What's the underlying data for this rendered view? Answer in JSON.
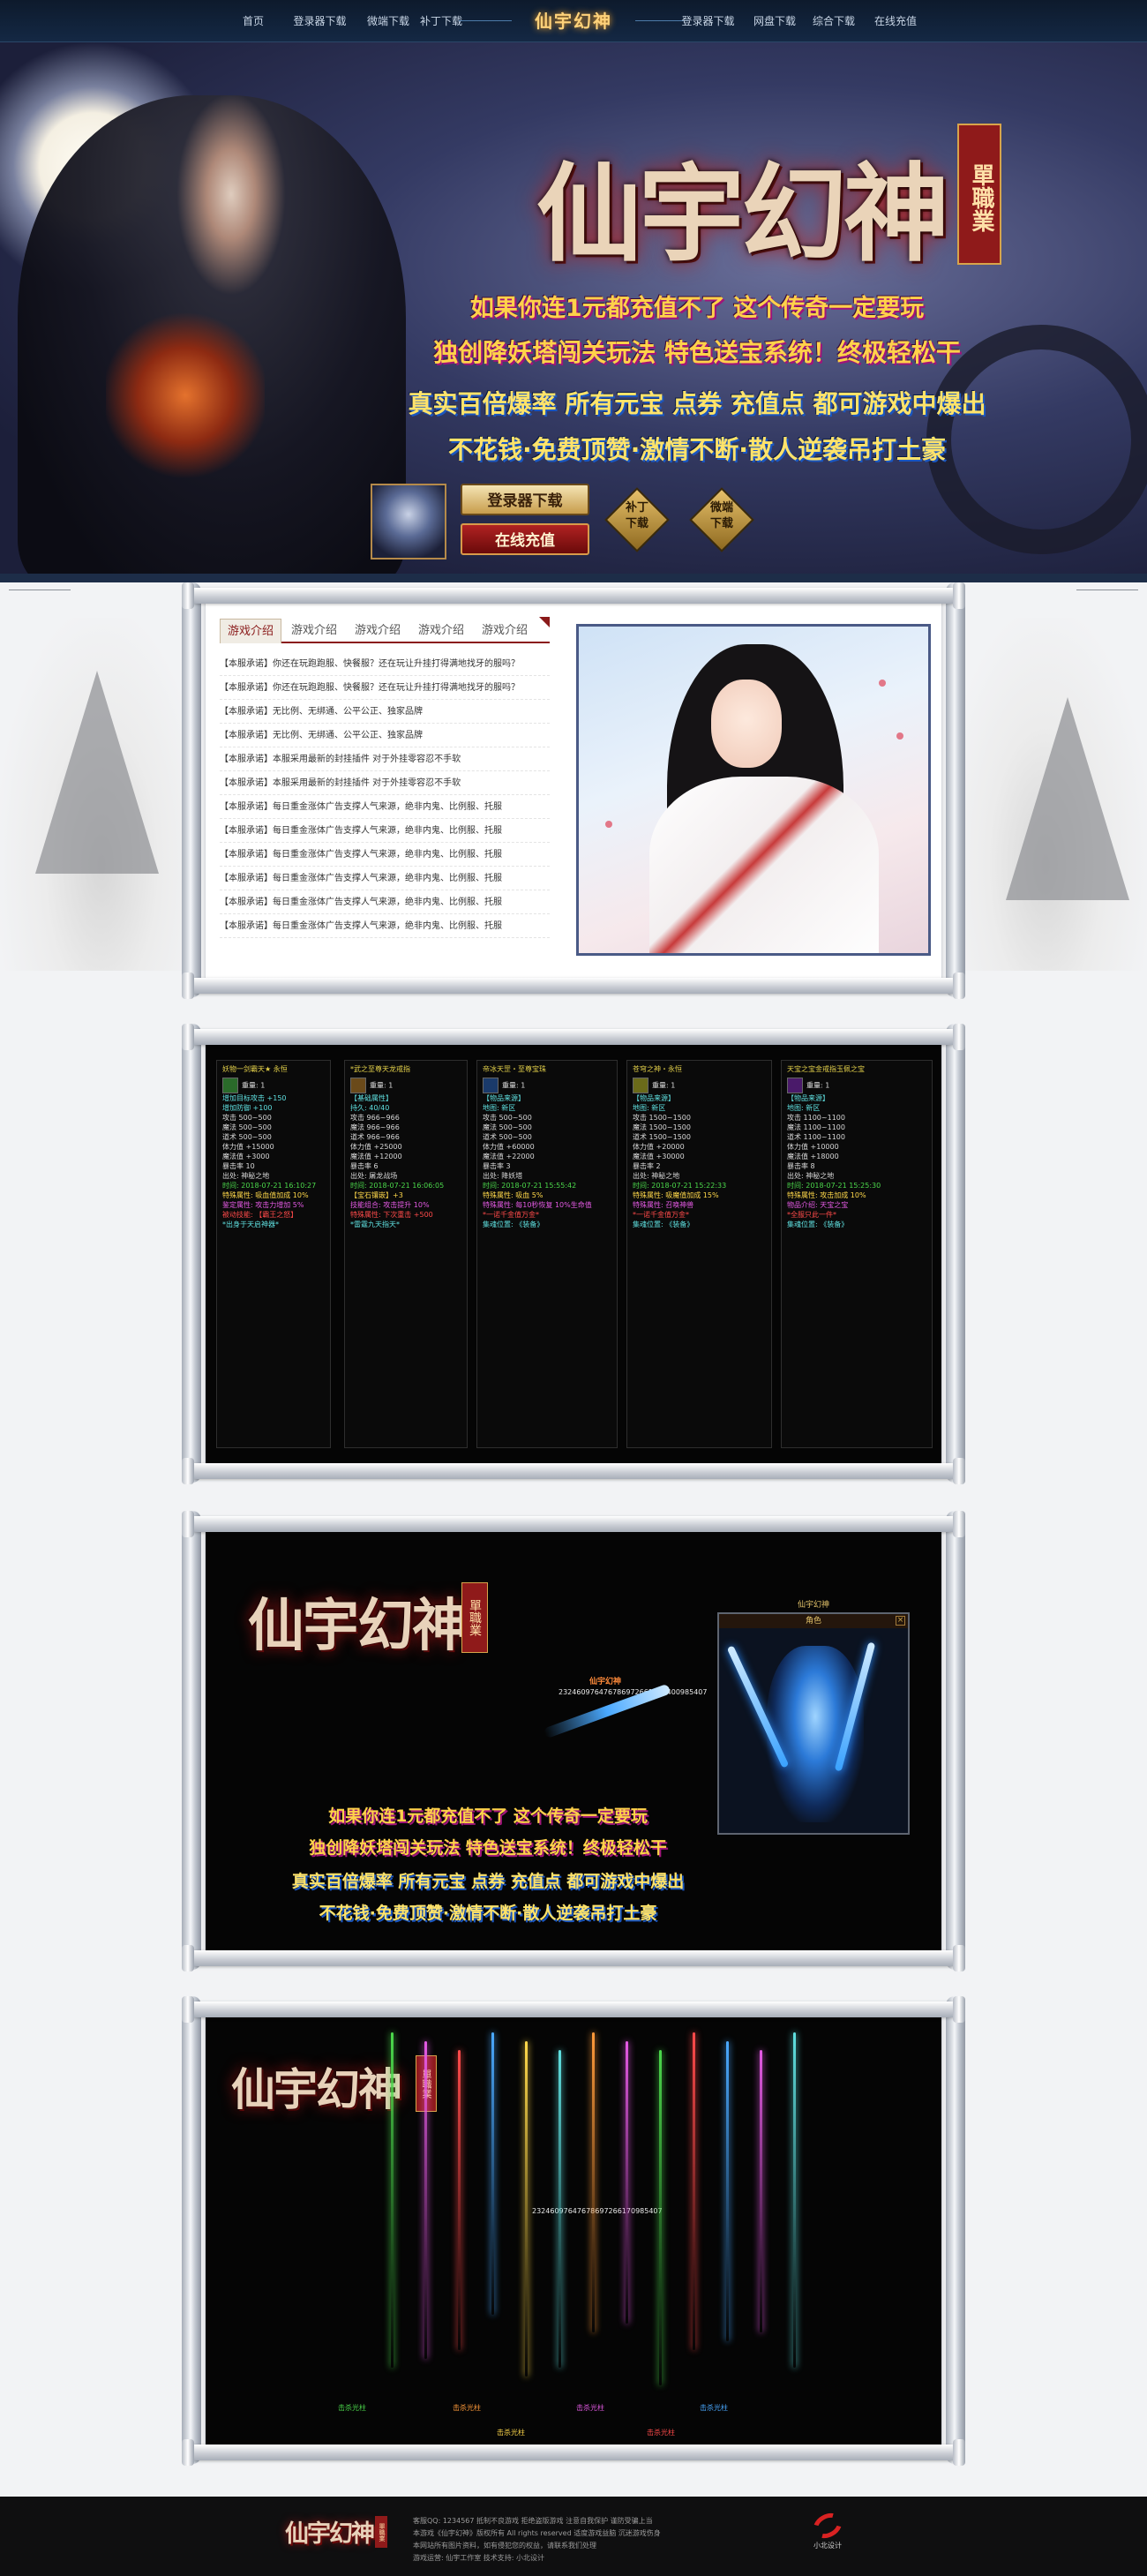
{
  "nav": {
    "logo": "仙宇幻神",
    "items": [
      "首页",
      "登录器下载",
      "微端下载",
      "补丁下载",
      "登录器下载",
      "网盘下载",
      "综合下载",
      "在线充值"
    ]
  },
  "hero": {
    "title": "仙宇幻神",
    "seal": "單職業",
    "slogans": [
      "如果你连1元都充值不了 这个传奇一定要玩",
      "独创降妖塔闯关玩法 特色送宝系统！终极轻松干",
      "真实百倍爆率 所有元宝 点券 充值点 都可游戏中爆出",
      "不花钱·免费顶赞·激情不断·散人逆袭吊打土豪"
    ],
    "download_button": "登录器下载",
    "pay_button": "在线充值",
    "patch_button": [
      "补丁",
      "下载"
    ],
    "micro_button": [
      "微端",
      "下载"
    ]
  },
  "intro": {
    "tabs": [
      "游戏介绍",
      "游戏介绍",
      "游戏介绍",
      "游戏介绍",
      "游戏介绍"
    ],
    "news": [
      "【本服承诺】你还在玩跑跑服、快餐服？还在玩让升挂打得满地找牙的服吗？",
      "【本服承诺】你还在玩跑跑服、快餐服？还在玩让升挂打得满地找牙的服吗？",
      "【本服承诺】无比例、无绑通、公平公正、独家品牌",
      "【本服承诺】无比例、无绑通、公平公正、独家品牌",
      "【本服承诺】本服采用最新的封挂插件 对于外挂零容忍不手软",
      "【本服承诺】本服采用最新的封挂插件 对于外挂零容忍不手软",
      "【本服承诺】每日重金涨体广告支撑人气来源，绝非内鬼、比例服、托服",
      "【本服承诺】每日重金涨体广告支撑人气来源，绝非内鬼、比例服、托服",
      "【本服承诺】每日重金涨体广告支撑人气来源，绝非内鬼、比例服、托服",
      "【本服承诺】每日重金涨体广告支撑人气来源，绝非内鬼、比例服、托服",
      "【本服承诺】每日重金涨体广告支撑人气来源，绝非内鬼、比例服、托服",
      "【本服承诺】每日重金涨体广告支撑人气来源，绝非内鬼、比例服、托服"
    ]
  },
  "items": {
    "cards": [
      {
        "title": "妖物一剑霸天★ 永恒",
        "name": "重量: 1",
        "stats": [
          "攻击 500~500",
          "魔法 500~500",
          "道术 500~500",
          "体力值 +15000",
          "魔法值 +3000",
          "暴击率 10"
        ],
        "extra": [
          "增加目标攻击 +150",
          "增加防御 +100"
        ],
        "tail": [
          "出处: 神秘之地",
          "时间: 2018-07-21 16:10:27",
          "特殊属性: 吸血值加成 10%",
          "鉴定属性: 攻击力增加 5%",
          "被动技能: 【霸王之怒】",
          "*出身于天启神器*"
        ]
      },
      {
        "title": "*武之至尊天龙戒指",
        "name": "重量: 1",
        "stats": [
          "攻击 966~966",
          "魔法 966~966",
          "道术 966~966",
          "体力值 +25000",
          "魔法值 +12000",
          "暴击率 6"
        ],
        "extra": [
          "【基础属性】",
          "持久: 40/40"
        ],
        "tail": [
          "出处: 屠龙战场",
          "时间: 2018-07-21 16:06:05",
          "【宝石镶嵌】+3",
          "技能组合: 攻击提升 10%",
          "特殊属性: 下次重击 +500",
          "*雷霆九天指天*"
        ]
      },
      {
        "title": "帝冰天罡・至尊宝珠",
        "name": "重量: 1",
        "stats": [
          "攻击 500~500",
          "魔法 500~500",
          "道术 500~500",
          "体力值 +60000",
          "魔法值 +22000",
          "暴击率 3"
        ],
        "extra": [
          "【物品来源】",
          "地图: 新区"
        ],
        "tail": [
          "出处: 降妖塔",
          "时间: 2018-07-21 15:55:42",
          "特殊属性: 吸血 5%",
          "特殊属性: 每10秒恢复 10%生命值",
          "*一诺千金值万金*",
          "集魂位置: 《装备》"
        ]
      },
      {
        "title": "苍穹之神・永恒",
        "name": "重量: 1",
        "stats": [
          "攻击 1500~1500",
          "魔法 1500~1500",
          "道术 1500~1500",
          "体力值 +20000",
          "魔法值 +30000",
          "暴击率 2"
        ],
        "extra": [
          "【物品来源】",
          "地图: 新区"
        ],
        "tail": [
          "出处: 神秘之地",
          "时间: 2018-07-21 15:22:33",
          "特殊属性: 吸魔值加成 15%",
          "特殊属性: 召唤神兽",
          "*一诺千金值万金*",
          "集魂位置: 《装备》"
        ]
      },
      {
        "title": "天宝之宝金戒指玉佩之宝",
        "name": "重量: 1",
        "stats": [
          "攻击 1100~1100",
          "魔法 1100~1100",
          "道术 1100~1100",
          "体力值 +10000",
          "魔法值 +18000",
          "暴击率 8"
        ],
        "extra": [
          "【物品来源】",
          "地图: 新区"
        ],
        "tail": [
          "出处: 神秘之地",
          "时间: 2018-07-21 15:25:30",
          "特殊属性: 攻击加成 10%",
          "物品介绍: 天宝之宝",
          "*全服只此一件*",
          "集魂位置: 《装备》"
        ]
      }
    ]
  },
  "promo": {
    "logo": "仙宇幻神",
    "seal": "單職業",
    "char_label": "仙宇幻神",
    "window_title": "角色",
    "window_close": "×",
    "nametag": "仙宇幻神",
    "id_number": "2324609764767869726617C1400985407",
    "slogans": [
      "如果你连1元都充值不了 这个传奇一定要玩",
      "独创降妖塔闯关玩法 特色送宝系统！终极轻松干",
      "真实百倍爆率 所有元宝 点券 充值点 都可游戏中爆出",
      "不花钱·免费顶赞·激情不断·散人逆袭吊打土豪"
    ]
  },
  "effects": {
    "logo": "仙宇幻神",
    "seal": "單職業",
    "id_number": "23246097647678697266170985407",
    "labels": [
      "击杀光柱",
      "击杀光柱",
      "击杀光柱",
      "击杀光柱",
      "击杀光柱",
      "击杀光柱"
    ]
  },
  "footer": {
    "logo": "仙宇幻神",
    "seal": "單職業",
    "lines": [
      "客服QQ: 1234567  抵制不良游戏 拒绝盗版游戏 注意自我保护 谨防受骗上当",
      "本游戏《仙宇幻神》版权所有 All rights reserved 适度游戏益脑 沉迷游戏伤身",
      "本网站所有图片资料，如有侵犯您的权益，请联系我们处理",
      "游戏运营: 仙宇工作室 技术支持: 小北设计"
    ],
    "brand": "小北设计"
  }
}
